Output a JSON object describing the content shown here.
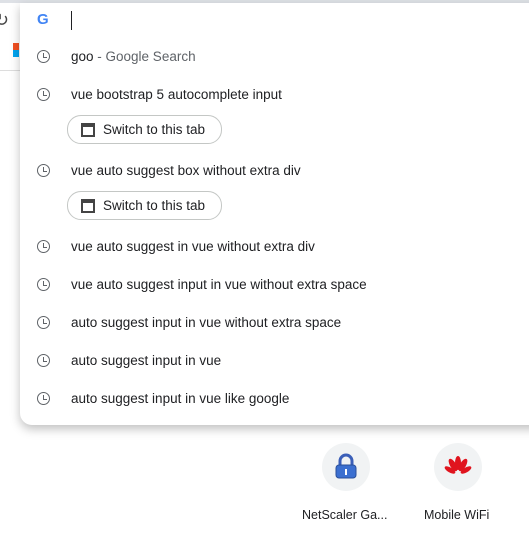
{
  "omnibox": {
    "value": ""
  },
  "suggestions": [
    {
      "text": "goo",
      "suffix": " - Google Search",
      "icon": "clock-icon"
    },
    {
      "text": "vue bootstrap 5 autocomplete input",
      "chip": "Switch to this tab",
      "icon": "clock-icon"
    },
    {
      "text": "vue auto suggest box without extra div",
      "chip": "Switch to this tab",
      "icon": "clock-icon"
    },
    {
      "text": "vue auto suggest in vue without extra div",
      "icon": "clock-icon"
    },
    {
      "text": "vue auto suggest input in vue without extra space",
      "icon": "clock-icon"
    },
    {
      "text": "auto suggest input in vue without extra space",
      "icon": "clock-icon"
    },
    {
      "text": "auto suggest input in vue",
      "icon": "clock-icon"
    },
    {
      "text": "auto suggest input in vue like google",
      "icon": "clock-icon"
    }
  ],
  "shortcuts": [
    {
      "label": "NetScaler Ga...",
      "icon": "lock-icon"
    },
    {
      "label": "Mobile WiFi",
      "icon": "huawei-icon"
    }
  ]
}
